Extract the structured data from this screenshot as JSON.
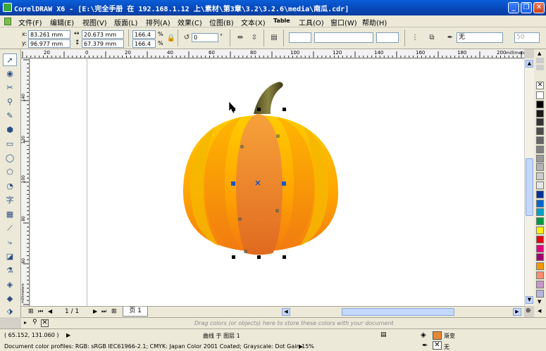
{
  "window": {
    "title": "CorelDRAW X6 - [E:\\完全手册 在 192.168.1.12 上\\素材\\第3章\\3.2\\3.2.6\\media\\南瓜.cdr]",
    "min": "_",
    "restore": "❐",
    "close": "✕"
  },
  "menu": {
    "items": [
      "文件(F)",
      "编辑(E)",
      "视图(V)",
      "版面(L)",
      "排列(A)",
      "效果(C)",
      "位图(B)",
      "文本(X)",
      "Table",
      "工具(O)",
      "窗口(W)",
      "帮助(H)"
    ]
  },
  "props": {
    "x_label": "x:",
    "x": "83.261 mm",
    "y_label": "y:",
    "y": "96.977 mm",
    "w": "20.673 mm",
    "h": "67.379 mm",
    "scale_x": "166.4",
    "scale_y": "166.4",
    "pct": "%",
    "rotation": "0",
    "deg": "°",
    "outline": "无",
    "outline_size": "50"
  },
  "ruler": {
    "unit": "millimeters",
    "h_ticks": [
      "20",
      "0",
      "20",
      "40",
      "60",
      "80",
      "100",
      "120",
      "140",
      "160",
      "180",
      "200"
    ],
    "v_ticks": [
      "140",
      "120",
      "100",
      "80",
      "60"
    ],
    "v_unit": "millimeters"
  },
  "pagebar": {
    "page_count": "1 / 1",
    "page_tab": "页 1"
  },
  "colorbar": {
    "hint": "Drag colors (or objects) here to store these colors with your document"
  },
  "status": {
    "coords": "( 65.152, 131.060 )",
    "object_info": "曲线 于 图层 1",
    "profiles": "Document color profiles: RGB: sRGB IEC61966-2.1; CMYK: Japan Color 2001 Coated; Grayscale: Dot Gain 15%",
    "fill_label": "渐变",
    "outline_label": "无"
  },
  "colors": {
    "accent": "#0846b8",
    "pumpkin_light": "#ffc400",
    "pumpkin_dark": "#e06a20",
    "stem": "#5f5a2a",
    "fill_swatch": "#e88834",
    "palette": [
      "#ffffff",
      "#000000",
      "#1a1a1a",
      "#333333",
      "#4d4d4d",
      "#666666",
      "#808080",
      "#999999",
      "#b3b3b3",
      "#cccccc",
      "#e6e6e6",
      "#003399",
      "#0066cc",
      "#00a0c6",
      "#009944",
      "#ffee00",
      "#e60012",
      "#e4007f",
      "#a0006e",
      "#f39800",
      "#ff8c6a",
      "#c896c8",
      "#b4b4dc"
    ]
  }
}
